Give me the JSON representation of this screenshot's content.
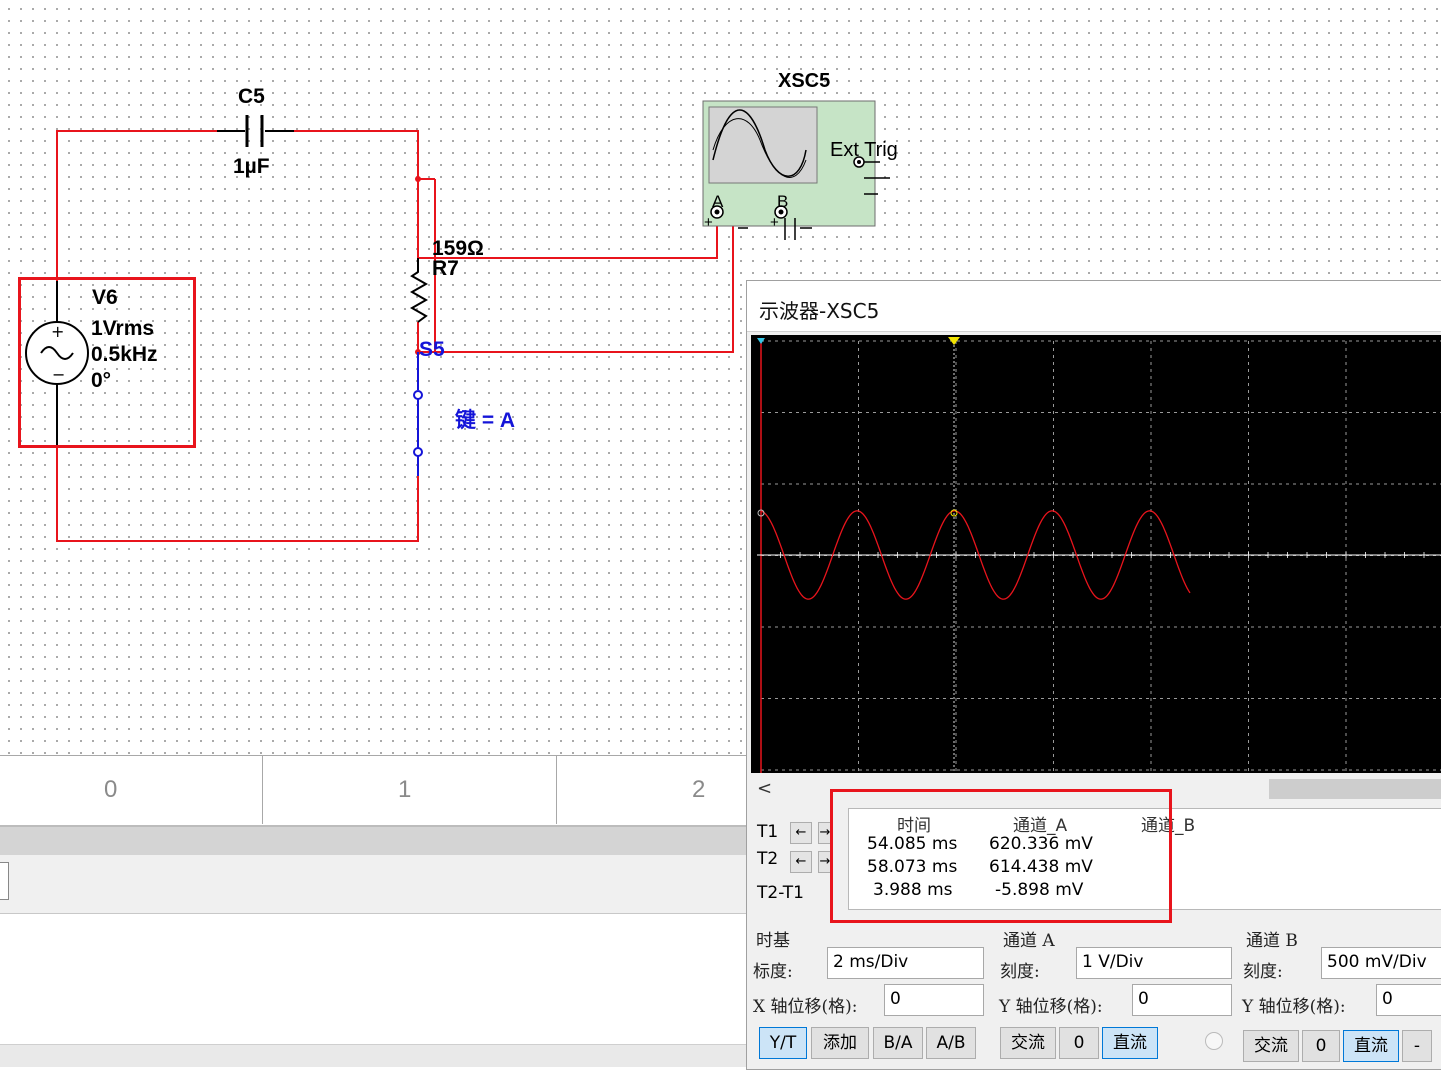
{
  "schematic": {
    "capacitor": {
      "ref": "C5",
      "value": "1µF"
    },
    "source": {
      "ref": "V6",
      "amplitude": "1Vrms",
      "frequency": "0.5kHz",
      "phase": "0°"
    },
    "resistor": {
      "value": "159Ω",
      "ref": "R7"
    },
    "switch": {
      "ref": "S5",
      "key_label": "键 = A"
    },
    "scope": {
      "ref": "XSC5",
      "ext_trig": "Ext Trig",
      "ch_a": "A",
      "ch_b": "B",
      "plus": "+",
      "minus": "_"
    }
  },
  "ruler": {
    "marks": [
      "0",
      "1",
      "2"
    ]
  },
  "oscilloscope": {
    "title": "示波器-XSC5",
    "scroll_left_arrow": "<",
    "cursors": {
      "t1_label": "T1",
      "t2_label": "T2",
      "diff_label": "T2-T1",
      "left_arrow": "←",
      "right_arrow": "→",
      "headers": {
        "time": "时间",
        "channel_a": "通道_A",
        "channel_b": "通道_B"
      },
      "rows": [
        {
          "time": "54.085 ms",
          "channel_a": "620.336 mV",
          "channel_b": ""
        },
        {
          "time": "58.073 ms",
          "channel_a": "614.438 mV",
          "channel_b": ""
        },
        {
          "time": "3.988 ms",
          "channel_a": "-5.898 mV",
          "channel_b": ""
        }
      ]
    },
    "timebase": {
      "title": "时基",
      "scale_label": "标度:",
      "scale_value": "2 ms/Div",
      "xpos_label": "X 轴位移(格):",
      "xpos_value": "0",
      "buttons": [
        "Y/T",
        "添加",
        "B/A",
        "A/B"
      ]
    },
    "channel_a": {
      "title": "通道 A",
      "scale_label": "刻度:",
      "scale_value": "1  V/Div",
      "ypos_label": "Y 轴位移(格):",
      "ypos_value": "0",
      "buttons": [
        "交流",
        "0",
        "直流"
      ]
    },
    "channel_b": {
      "title": "通道 B",
      "scale_label": "刻度:",
      "scale_value": "500 mV/Div",
      "ypos_label": "Y 轴位移(格):",
      "ypos_value": "0",
      "buttons": [
        "交流",
        "0",
        "直流",
        "-"
      ]
    },
    "trace_color": "#e8141c",
    "grid_color": "#9a9a9a"
  },
  "colors": {
    "wire": "#e8141c",
    "highlight_box": "#e8141c",
    "switch_blue": "#1414d8",
    "scope_body": "#c6e4c6"
  }
}
